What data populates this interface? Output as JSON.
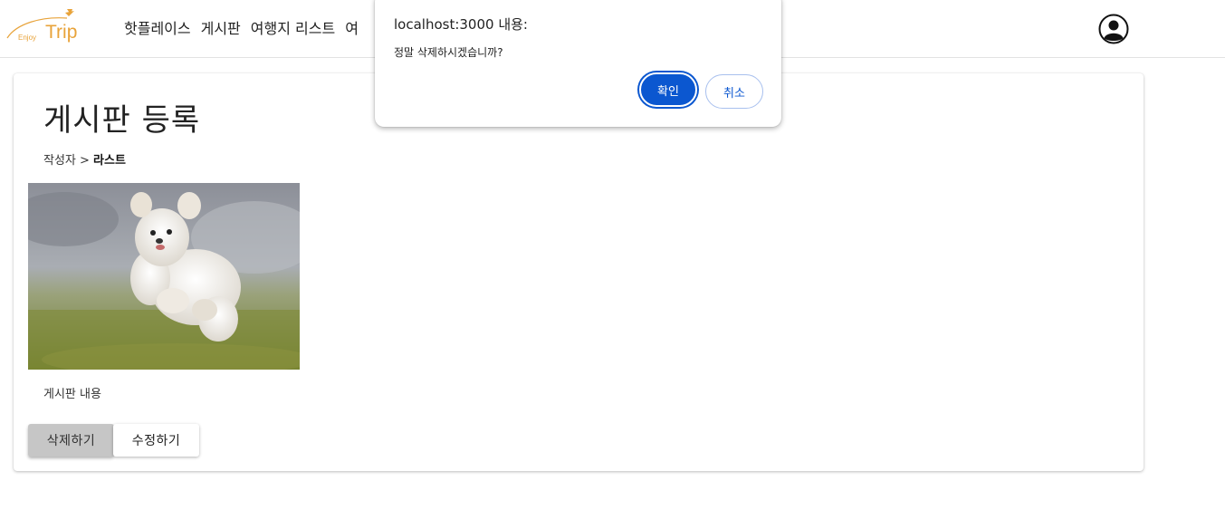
{
  "header": {
    "logo_small": "Enjoy",
    "logo_big": "Trip",
    "nav": [
      "핫플레이스",
      "게시판",
      "여행지 리스트",
      "여"
    ]
  },
  "post": {
    "title": "게시판 등록",
    "author_label": "작성자 >",
    "author_name": "라스트",
    "content": "게시판 내용",
    "delete_label": "삭제하기",
    "edit_label": "수정하기"
  },
  "dialog": {
    "title": "localhost:3000 내용:",
    "message": "정말 삭제하시겠습니까?",
    "ok_label": "확인",
    "cancel_label": "취소"
  },
  "colors": {
    "brand": "#e8a33a",
    "dialog_primary": "#0b57d0"
  }
}
